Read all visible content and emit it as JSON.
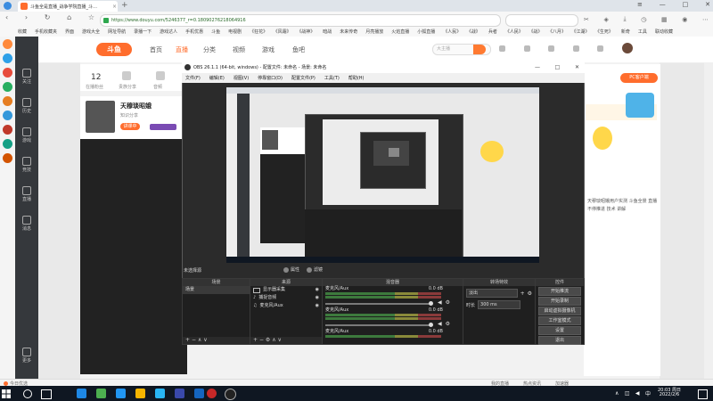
{
  "browser": {
    "tab_title": "斗鱼全是直播_战争学院直播_斗…",
    "url": "https://www.douyu.com/5246377_r=0.18090276218064916",
    "bookmarks": [
      "收藏",
      "手机收藏夹",
      "界面",
      "游戏大全",
      "网址导航",
      "录播一下",
      "游戏达人",
      "手机优惠",
      "斗鱼",
      "电视剧",
      "《狂花》",
      "《风霜》",
      "《战神》",
      "暗战",
      "未来传奇",
      "月亮播放",
      "火焰直播",
      "小狐直播",
      "《人民》",
      "《战》",
      "兵者",
      "《人民》",
      "《战》",
      "《八月》",
      "《江湖》",
      "《生死》",
      "新奇",
      "工具",
      "联动收藏"
    ],
    "status_left": "今日优选",
    "status_right": [
      "我的直播",
      "热点资讯",
      "加速器"
    ],
    "time": "20:03 周日",
    "date": "2022/2/6"
  },
  "douyu": {
    "logo": "斗鱼",
    "menu": [
      "首页",
      "直播",
      "分类",
      "视频",
      "游戏",
      "鱼吧"
    ],
    "search_placeholder": "大主播",
    "left_nav": [
      "关注",
      "历史",
      "游戏",
      "竞技",
      "直播",
      "消息",
      "更多"
    ],
    "info": {
      "count": "12",
      "labels": [
        "在播粉丝",
        "贵族分享",
        "音频"
      ]
    },
    "room": {
      "name": "天穆琰昭娥",
      "sub": "知识分享",
      "badge": "讲课中"
    },
    "pc_button": "PC客户端",
    "right_text": "天穆琰昭娥用户实测 斗鱼全景 直播 不停推进 技术 讲解"
  },
  "obs": {
    "title": "OBS 26.1.1 (64-bit, windows) - 配置文件: 未命名 - 场景: 未命名",
    "menu": [
      "文件(F)",
      "编辑(E)",
      "视图(V)",
      "停靠窗口(D)",
      "配置文件(P)",
      "工具(T)",
      "帮助(H)"
    ],
    "scene_label": "未选择源",
    "sub_buttons": [
      "属性",
      "滤镜"
    ],
    "panels": {
      "scenes": {
        "title": "场景",
        "items": [
          "场景"
        ]
      },
      "sources": {
        "title": "来源",
        "items": [
          "显示器采集",
          "捕捉音频",
          "麦克风/Aux"
        ]
      },
      "mixer": {
        "title": "混音器",
        "channels": [
          {
            "name": "麦克风/Aux",
            "db": "0.0 dB"
          },
          {
            "name": "麦克风/Aux",
            "db": "0.0 dB"
          },
          {
            "name": "麦克风/Aux",
            "db": "0.0 dB"
          }
        ]
      },
      "transitions": {
        "title": "转场特效",
        "effect": "淡出",
        "duration_label": "时长",
        "duration": "300 ms"
      },
      "controls": {
        "title": "控件",
        "buttons": [
          "开始推流",
          "开始录制",
          "启动虚拟摄像机",
          "工作室模式",
          "设置",
          "退出"
        ]
      }
    }
  }
}
